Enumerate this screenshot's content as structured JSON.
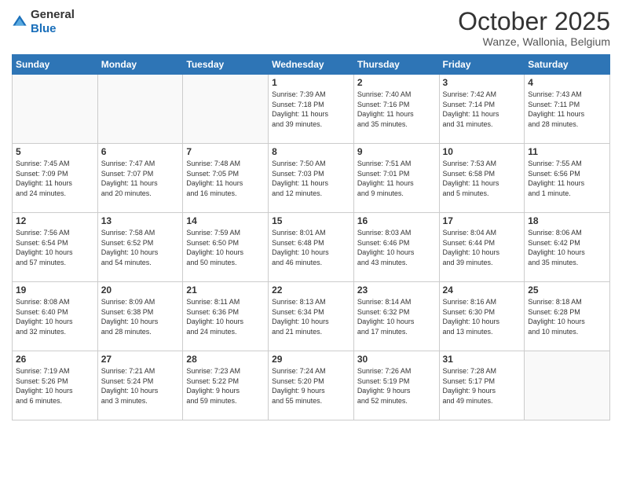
{
  "header": {
    "logo_general": "General",
    "logo_blue": "Blue",
    "title": "October 2025",
    "location": "Wanze, Wallonia, Belgium"
  },
  "days_of_week": [
    "Sunday",
    "Monday",
    "Tuesday",
    "Wednesday",
    "Thursday",
    "Friday",
    "Saturday"
  ],
  "weeks": [
    [
      {
        "day": "",
        "info": ""
      },
      {
        "day": "",
        "info": ""
      },
      {
        "day": "",
        "info": ""
      },
      {
        "day": "1",
        "info": "Sunrise: 7:39 AM\nSunset: 7:18 PM\nDaylight: 11 hours\nand 39 minutes."
      },
      {
        "day": "2",
        "info": "Sunrise: 7:40 AM\nSunset: 7:16 PM\nDaylight: 11 hours\nand 35 minutes."
      },
      {
        "day": "3",
        "info": "Sunrise: 7:42 AM\nSunset: 7:14 PM\nDaylight: 11 hours\nand 31 minutes."
      },
      {
        "day": "4",
        "info": "Sunrise: 7:43 AM\nSunset: 7:11 PM\nDaylight: 11 hours\nand 28 minutes."
      }
    ],
    [
      {
        "day": "5",
        "info": "Sunrise: 7:45 AM\nSunset: 7:09 PM\nDaylight: 11 hours\nand 24 minutes."
      },
      {
        "day": "6",
        "info": "Sunrise: 7:47 AM\nSunset: 7:07 PM\nDaylight: 11 hours\nand 20 minutes."
      },
      {
        "day": "7",
        "info": "Sunrise: 7:48 AM\nSunset: 7:05 PM\nDaylight: 11 hours\nand 16 minutes."
      },
      {
        "day": "8",
        "info": "Sunrise: 7:50 AM\nSunset: 7:03 PM\nDaylight: 11 hours\nand 12 minutes."
      },
      {
        "day": "9",
        "info": "Sunrise: 7:51 AM\nSunset: 7:01 PM\nDaylight: 11 hours\nand 9 minutes."
      },
      {
        "day": "10",
        "info": "Sunrise: 7:53 AM\nSunset: 6:58 PM\nDaylight: 11 hours\nand 5 minutes."
      },
      {
        "day": "11",
        "info": "Sunrise: 7:55 AM\nSunset: 6:56 PM\nDaylight: 11 hours\nand 1 minute."
      }
    ],
    [
      {
        "day": "12",
        "info": "Sunrise: 7:56 AM\nSunset: 6:54 PM\nDaylight: 10 hours\nand 57 minutes."
      },
      {
        "day": "13",
        "info": "Sunrise: 7:58 AM\nSunset: 6:52 PM\nDaylight: 10 hours\nand 54 minutes."
      },
      {
        "day": "14",
        "info": "Sunrise: 7:59 AM\nSunset: 6:50 PM\nDaylight: 10 hours\nand 50 minutes."
      },
      {
        "day": "15",
        "info": "Sunrise: 8:01 AM\nSunset: 6:48 PM\nDaylight: 10 hours\nand 46 minutes."
      },
      {
        "day": "16",
        "info": "Sunrise: 8:03 AM\nSunset: 6:46 PM\nDaylight: 10 hours\nand 43 minutes."
      },
      {
        "day": "17",
        "info": "Sunrise: 8:04 AM\nSunset: 6:44 PM\nDaylight: 10 hours\nand 39 minutes."
      },
      {
        "day": "18",
        "info": "Sunrise: 8:06 AM\nSunset: 6:42 PM\nDaylight: 10 hours\nand 35 minutes."
      }
    ],
    [
      {
        "day": "19",
        "info": "Sunrise: 8:08 AM\nSunset: 6:40 PM\nDaylight: 10 hours\nand 32 minutes."
      },
      {
        "day": "20",
        "info": "Sunrise: 8:09 AM\nSunset: 6:38 PM\nDaylight: 10 hours\nand 28 minutes."
      },
      {
        "day": "21",
        "info": "Sunrise: 8:11 AM\nSunset: 6:36 PM\nDaylight: 10 hours\nand 24 minutes."
      },
      {
        "day": "22",
        "info": "Sunrise: 8:13 AM\nSunset: 6:34 PM\nDaylight: 10 hours\nand 21 minutes."
      },
      {
        "day": "23",
        "info": "Sunrise: 8:14 AM\nSunset: 6:32 PM\nDaylight: 10 hours\nand 17 minutes."
      },
      {
        "day": "24",
        "info": "Sunrise: 8:16 AM\nSunset: 6:30 PM\nDaylight: 10 hours\nand 13 minutes."
      },
      {
        "day": "25",
        "info": "Sunrise: 8:18 AM\nSunset: 6:28 PM\nDaylight: 10 hours\nand 10 minutes."
      }
    ],
    [
      {
        "day": "26",
        "info": "Sunrise: 7:19 AM\nSunset: 5:26 PM\nDaylight: 10 hours\nand 6 minutes."
      },
      {
        "day": "27",
        "info": "Sunrise: 7:21 AM\nSunset: 5:24 PM\nDaylight: 10 hours\nand 3 minutes."
      },
      {
        "day": "28",
        "info": "Sunrise: 7:23 AM\nSunset: 5:22 PM\nDaylight: 9 hours\nand 59 minutes."
      },
      {
        "day": "29",
        "info": "Sunrise: 7:24 AM\nSunset: 5:20 PM\nDaylight: 9 hours\nand 55 minutes."
      },
      {
        "day": "30",
        "info": "Sunrise: 7:26 AM\nSunset: 5:19 PM\nDaylight: 9 hours\nand 52 minutes."
      },
      {
        "day": "31",
        "info": "Sunrise: 7:28 AM\nSunset: 5:17 PM\nDaylight: 9 hours\nand 49 minutes."
      },
      {
        "day": "",
        "info": ""
      }
    ]
  ]
}
